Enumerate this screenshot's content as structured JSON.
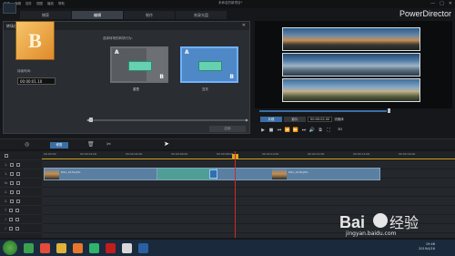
{
  "window": {
    "menu": [
      "文件",
      "编辑",
      "插件",
      "视图",
      "播放",
      "帮助"
    ],
    "project_title": "未命名的新项目*",
    "controls": [
      "—",
      "□",
      "✕"
    ],
    "brand": "PowerDirector"
  },
  "tabs": [
    {
      "label": "捕获"
    },
    {
      "label": "编辑",
      "active": true
    },
    {
      "label": "制作"
    },
    {
      "label": "刻录光盘"
    }
  ],
  "transition_panel": {
    "title": "转场设置",
    "close": "✕",
    "thumb_letter": "B",
    "duration_label": "持续时间:",
    "duration_value": "00:00:01.10",
    "behavior_label": "选择转场的转场行为:",
    "options": [
      {
        "a": "A",
        "b": "B",
        "caption": "重叠"
      },
      {
        "a": "A",
        "b": "B",
        "caption": "交叉",
        "selected": true
      }
    ],
    "apply_label": "应用"
  },
  "preview": {
    "mode_clip": "片段",
    "mode_movie": "影片",
    "timecode": "00:00:02.00",
    "quality": "流媒体",
    "view3d": "3D",
    "transport": [
      "▶",
      "■",
      "⏮",
      "⏪",
      "⏩",
      "⏭",
      "🔊",
      "⧉",
      "⛶"
    ]
  },
  "toolbar": {
    "designer_label": "修剪",
    "delete_icon": "trash-icon",
    "split_icon": "split-icon"
  },
  "timeline": {
    "ruler_ticks": [
      "00:00:00",
      "00:00:02:00",
      "00:00:04:00",
      "00:00:06:00",
      "00:00:08:00",
      "00:00:10:00",
      "00:00:12:00",
      "00:00:14:00",
      "00:00:16:00"
    ],
    "tracks": [
      "1.",
      "1.",
      "fx",
      "2.",
      "2.",
      "T",
      "♪",
      "♪"
    ],
    "clips": [
      {
        "label": "DSC_0131.JPG"
      },
      {
        "label": "DSC_0130.JPG"
      }
    ]
  },
  "taskbar": {
    "time": "19:46",
    "date": "2019/4/16"
  },
  "watermark": {
    "text": "jingyan.baidu.com"
  }
}
